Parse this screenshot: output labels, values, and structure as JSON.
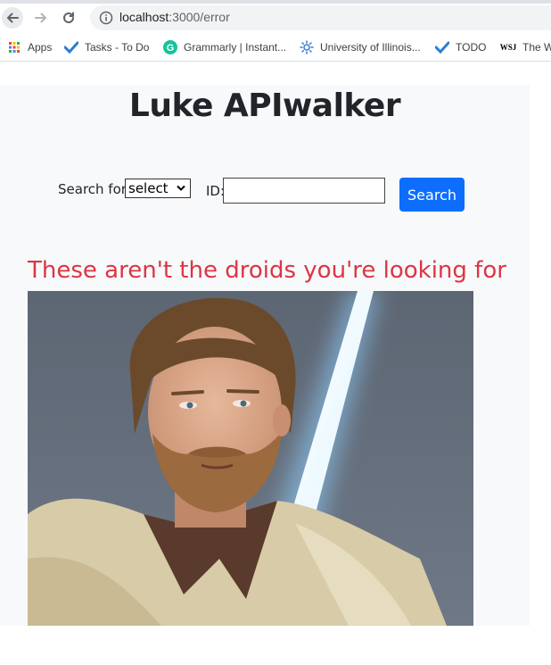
{
  "browser": {
    "url_host": "localhost",
    "url_path": ":3000/error",
    "bookmarks": [
      "Apps",
      "Tasks - To Do",
      "Grammarly | Instant...",
      "University of Illinois...",
      "TODO",
      "The W"
    ],
    "bookmark_icons": {
      "wsj": "WSJ"
    }
  },
  "page": {
    "title": "Luke APIwalker",
    "search_label": "Search for:",
    "select_value": "select",
    "id_label": "ID:",
    "id_value": "",
    "search_button": "Search",
    "error_message": "These aren't the droids you're looking for"
  },
  "colors": {
    "primary": "#0d6efd",
    "danger": "#dc3545",
    "page_bg": "#f8f9fa"
  }
}
